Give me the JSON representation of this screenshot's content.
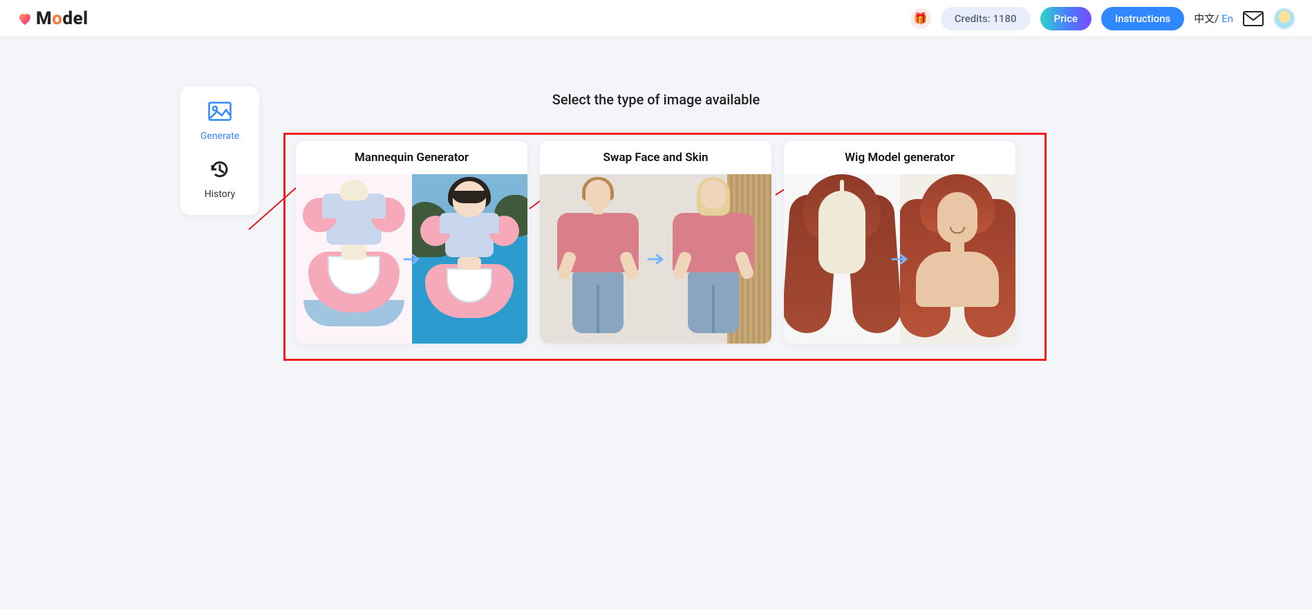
{
  "header": {
    "logo_text_parts": {
      "m": "M",
      "o1": "o",
      "rest": "del"
    },
    "credits_label": "Credits: 1180",
    "price_label": "Price",
    "instructions_label": "Instructions",
    "lang_zh": "中文/",
    "lang_en": " En"
  },
  "sidebar": {
    "items": [
      {
        "label": "Generate",
        "icon": "image-icon",
        "active": true
      },
      {
        "label": "History",
        "icon": "history-icon",
        "active": false
      }
    ]
  },
  "page": {
    "title": "Select the type of image available"
  },
  "cards": [
    {
      "title": "Mannequin Generator"
    },
    {
      "title": "Swap Face and Skin"
    },
    {
      "title": "Wig Model generator"
    }
  ],
  "fabs": [
    {
      "name": "play-video-fab",
      "icon": "play"
    },
    {
      "name": "feedback-fab",
      "icon": "note-edit"
    },
    {
      "name": "help-fab",
      "icon": "help"
    }
  ]
}
